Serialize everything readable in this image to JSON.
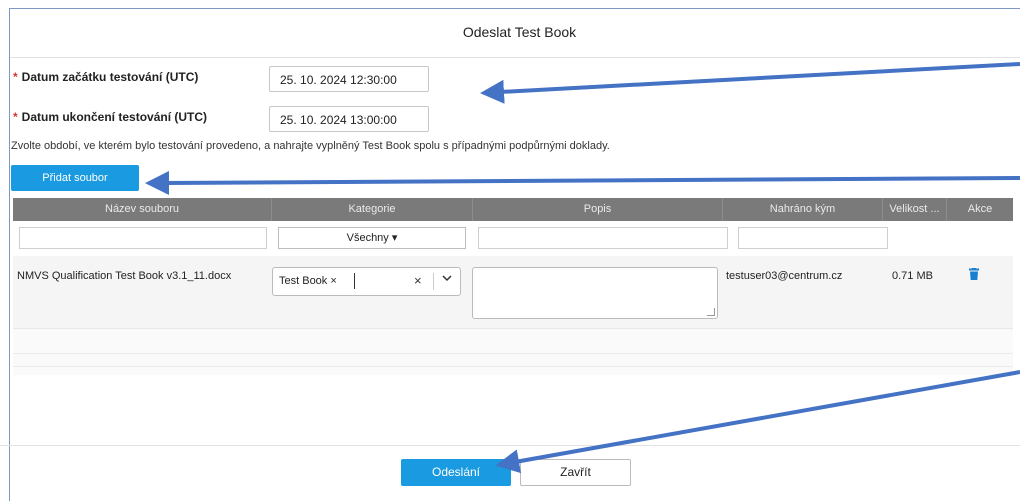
{
  "dialog": {
    "title": "Odeslat Test Book",
    "close_symbol": "×"
  },
  "form": {
    "required_mark": "*",
    "start_label": "Datum začátku testování (UTC)",
    "start_value": "25. 10. 2024 12:30:00",
    "end_label": "Datum ukončení testování (UTC)",
    "end_value": "25. 10. 2024 13:00:00",
    "instructions": "Zvolte období, ve kterém bylo testování provedeno, a nahrajte vyplněný Test Book spolu s případnými podpůrnými doklady.",
    "add_file_button": "Přidat soubor"
  },
  "grid": {
    "headers": [
      "Název souboru",
      "Kategorie",
      "Popis",
      "Nahráno kým",
      "Velikost ...",
      "Akce"
    ],
    "category_filter": "Všechny ▾",
    "rows": [
      {
        "file_name": "NMVS Qualification Test Book v3.1_11.docx",
        "category_tag": "Test Book",
        "tag_remove": "×",
        "clear": "×",
        "chevron": "⌵",
        "uploaded_by": "testuser03@centrum.cz",
        "size": "0.71 MB",
        "action_icon": "trash-icon"
      }
    ]
  },
  "footer": {
    "submit_button": "Odeslání",
    "close_button": "Zavřít"
  },
  "colors": {
    "accent": "#1a9ae0",
    "header_bg": "#7a7a7a",
    "arrow": "#4472c4"
  }
}
